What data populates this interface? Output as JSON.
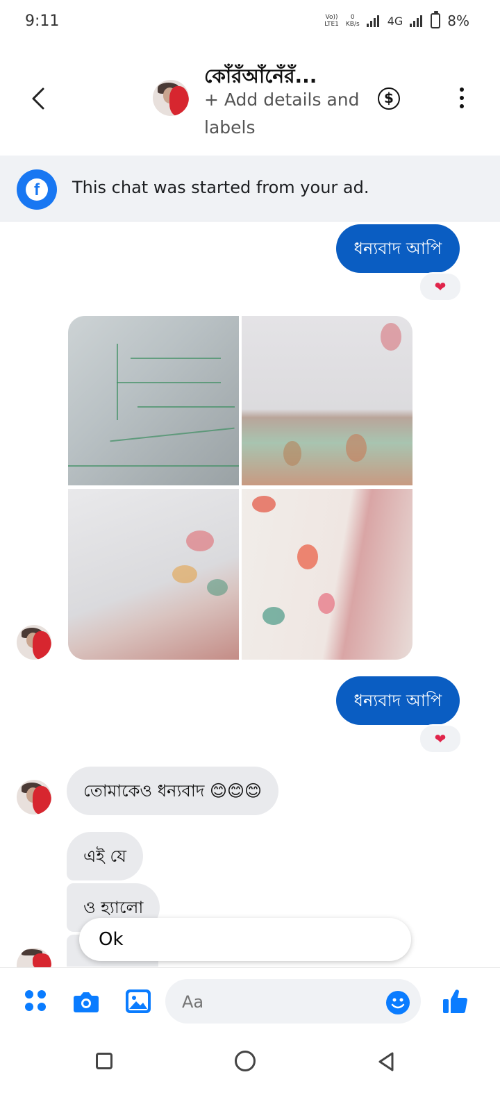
{
  "status_bar": {
    "time": "9:11",
    "volte_top": "Vo))",
    "volte_bottom": "LTE1",
    "speed_top": "0",
    "speed_bottom": "KB/s",
    "network": "4G",
    "battery": "8%"
  },
  "header": {
    "contact_name": "কোঁরঁআঁনেঁরঁ...",
    "add_details": "+ Add details and labels",
    "dollar_icon": "$"
  },
  "ad_banner": {
    "text": "This chat was started from your ad."
  },
  "messages": [
    {
      "direction": "out",
      "text": "ধন্যবাদ আপি",
      "reaction": "❤"
    },
    {
      "direction": "in",
      "type": "photos",
      "count": 4
    },
    {
      "direction": "out",
      "text": "ধন্যবাদ আপি",
      "reaction": "❤"
    },
    {
      "direction": "in",
      "text": "তোমাকেও ধন্যবাদ 😊😊😊"
    },
    {
      "direction": "in",
      "text": "এই যে"
    },
    {
      "direction": "in",
      "text": "ও হ্যালো"
    }
  ],
  "quick_reply": "Ok",
  "composer": {
    "placeholder": "Aa"
  },
  "colors": {
    "accent": "#0a7cff",
    "outgoing_bubble": "#0a5dc2",
    "incoming_bubble": "#e9eaed",
    "banner_bg": "#f0f2f5",
    "facebook_blue": "#1877f2",
    "reaction_heart": "#e0244a"
  },
  "icons": {
    "back": "chevron-left-icon",
    "payment": "dollar-circle-icon",
    "more": "more-vertical-icon",
    "facebook": "facebook-logo-icon",
    "menu": "four-dots-menu-icon",
    "camera": "camera-icon",
    "gallery": "gallery-icon",
    "emoji": "emoji-icon",
    "like": "thumbs-up-icon"
  }
}
